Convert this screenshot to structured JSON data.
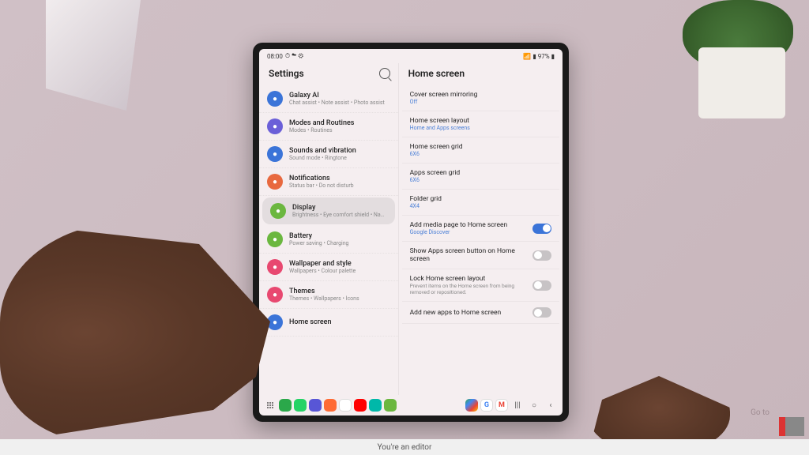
{
  "status": {
    "time": "08:00",
    "battery": "97%"
  },
  "leftPane": {
    "title": "Settings"
  },
  "rightPane": {
    "title": "Home screen"
  },
  "settings": [
    {
      "label": "Galaxy AI",
      "sub": "Chat assist • Note assist • Photo assist",
      "color": "#3b74d8"
    },
    {
      "label": "Modes and Routines",
      "sub": "Modes • Routines",
      "color": "#6b5fd8"
    },
    {
      "label": "Sounds and vibration",
      "sub": "Sound mode • Ringtone",
      "color": "#3b74d8"
    },
    {
      "label": "Notifications",
      "sub": "Status bar • Do not disturb",
      "color": "#e8693f"
    },
    {
      "label": "Display",
      "sub": "Brightness • Eye comfort shield • Navigation bar",
      "color": "#6bb73f",
      "selected": true
    },
    {
      "label": "Battery",
      "sub": "Power saving • Charging",
      "color": "#6bb73f"
    },
    {
      "label": "Wallpaper and style",
      "sub": "Wallpapers • Colour palette",
      "color": "#e84870"
    },
    {
      "label": "Themes",
      "sub": "Themes • Wallpapers • Icons",
      "color": "#e84870"
    },
    {
      "label": "Home screen",
      "sub": "",
      "color": "#3b74d8"
    }
  ],
  "details": [
    {
      "label": "Cover screen mirroring",
      "value": "Off",
      "type": "link"
    },
    {
      "label": "Home screen layout",
      "value": "Home and Apps screens",
      "type": "link"
    },
    {
      "label": "Home screen grid",
      "value": "6X6",
      "type": "link"
    },
    {
      "label": "Apps screen grid",
      "value": "6X6",
      "type": "link"
    },
    {
      "label": "Folder grid",
      "value": "4X4",
      "type": "link"
    },
    {
      "label": "Add media page to Home screen",
      "value": "Google Discover",
      "type": "toggle",
      "on": true
    },
    {
      "label": "Show Apps screen button on Home screen",
      "type": "toggle",
      "on": false
    },
    {
      "label": "Lock Home screen layout",
      "desc": "Prevent items on the Home screen from being removed or repositioned.",
      "type": "toggle",
      "on": false
    },
    {
      "label": "Add new apps to Home screen",
      "type": "toggle",
      "on": false
    }
  ],
  "footer": "You're an editor",
  "goText": "Go to"
}
